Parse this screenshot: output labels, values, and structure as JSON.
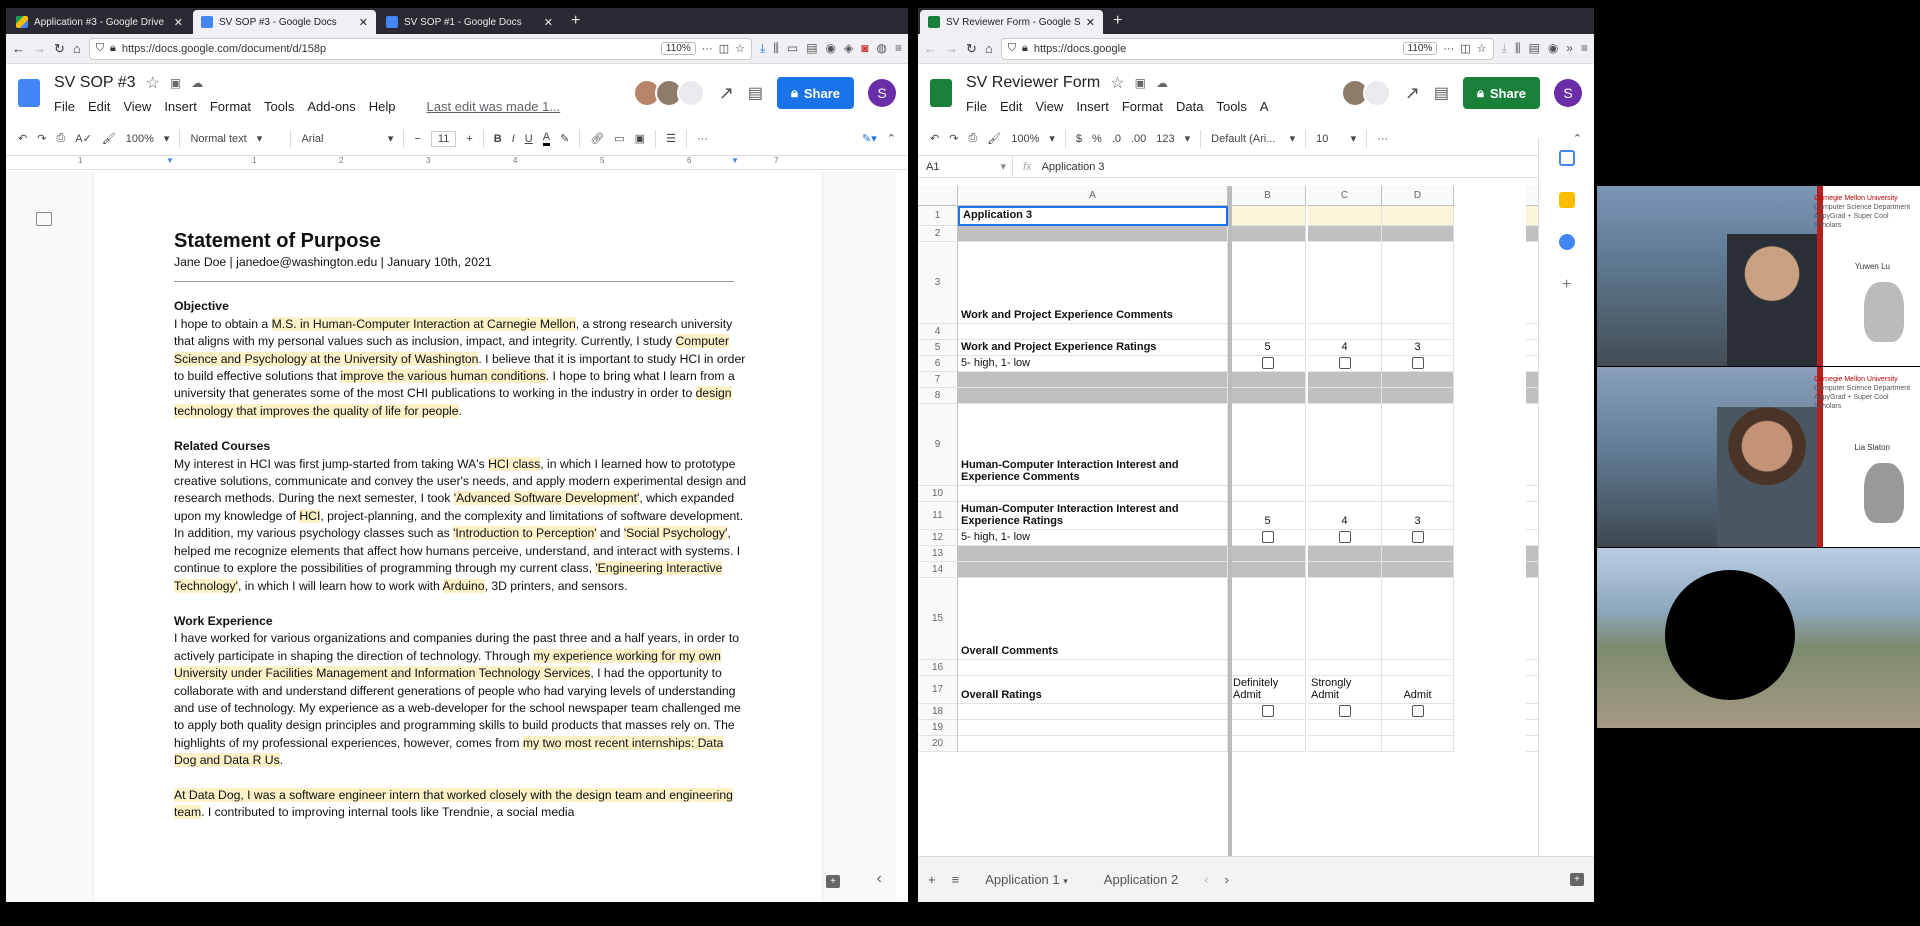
{
  "left_window": {
    "tabs": [
      {
        "title": "Application #3 - Google Drive",
        "active": false
      },
      {
        "title": "SV SOP #3 - Google Docs",
        "active": true
      },
      {
        "title": "SV SOP #1 - Google Docs",
        "active": false
      }
    ],
    "url": "https://docs.google.com/document/d/158p",
    "url_host": "docs.google.com",
    "zoom": "110%",
    "doc_name": "SV SOP #3",
    "menus": [
      "File",
      "Edit",
      "View",
      "Insert",
      "Format",
      "Tools",
      "Add-ons",
      "Help"
    ],
    "last_edit": "Last edit was made 1...",
    "share_label": "Share",
    "account_initial": "S",
    "toolbar": {
      "zoom": "100%",
      "style": "Normal text",
      "font": "Arial",
      "size": "11"
    },
    "ruler_numbers": [
      "1",
      "1",
      "2",
      "3",
      "4",
      "5",
      "6",
      "7"
    ],
    "document": {
      "title": "Statement of Purpose",
      "subtitle": "Jane Doe | janedoe@washington.edu | January 10th, 2021",
      "sections": [
        {
          "heading": "Objective",
          "segments": [
            {
              "t": "I hope to obtain a ",
              "h": false
            },
            {
              "t": "M.S. in Human-Computer Interaction at Carnegie Mellon",
              "h": true
            },
            {
              "t": ", a strong research university that aligns with my personal values such as inclusion, impact, and integrity. Currently, I study ",
              "h": false
            },
            {
              "t": "Computer Science and Psychology at the University of Washington",
              "h": true
            },
            {
              "t": ". I believe that it is important to study HCI in order to build effective solutions that ",
              "h": false
            },
            {
              "t": "improve the various human conditions",
              "h": true
            },
            {
              "t": ". I hope to bring what I learn from a university that generates some of the most CHI publications to working in the industry in order to ",
              "h": false
            },
            {
              "t": "design technology that improves the quality of life for people",
              "h": true
            },
            {
              "t": ".",
              "h": false
            }
          ]
        },
        {
          "heading": "Related Courses",
          "segments": [
            {
              "t": "My interest in HCI was first jump-started from taking WA's ",
              "h": false
            },
            {
              "t": "HCI class",
              "h": true
            },
            {
              "t": ", in which I learned how to prototype creative solutions, communicate and convey the user's needs, and apply modern experimental design and research methods. During the next semester, I took ",
              "h": false
            },
            {
              "t": "'Advanced Software Development'",
              "h": true
            },
            {
              "t": ", which expanded upon my knowledge of ",
              "h": false
            },
            {
              "t": "HCI",
              "h": true
            },
            {
              "t": ", project-planning, and the complexity and limitations of software development. In addition, my various psychology classes such as ",
              "h": false
            },
            {
              "t": "'Introduction to Perception'",
              "h": true
            },
            {
              "t": " and ",
              "h": false
            },
            {
              "t": "'Social Psychology'",
              "h": true
            },
            {
              "t": ", helped me recognize elements that affect how humans perceive, understand, and interact with systems. I continue to explore the possibilities of programming through my current class, ",
              "h": false
            },
            {
              "t": "'Engineering Interactive Technology'",
              "h": true
            },
            {
              "t": ", in which I will learn how to work with ",
              "h": false
            },
            {
              "t": "Arduino",
              "h": true
            },
            {
              "t": ", 3D printers, and sensors.",
              "h": false
            }
          ]
        },
        {
          "heading": "Work Experience",
          "segments": [
            {
              "t": "I have worked for various organizations and companies during the past three and a half years, in order to actively participate in shaping the direction of technology. Through ",
              "h": false
            },
            {
              "t": "my experience working for my own University under Facilities Management and Information Technology Services",
              "h": true
            },
            {
              "t": ", I had the opportunity to collaborate with and understand different generations of people who had varying levels of understanding and use of technology. My experience as a web-developer for the school newspaper team challenged me to apply both quality design principles and programming skills to build products that masses rely on. The highlights of my professional experiences, however, comes from ",
              "h": false
            },
            {
              "t": "my two most recent internships: Data Dog and Data R Us",
              "h": true
            },
            {
              "t": ".",
              "h": false
            }
          ]
        },
        {
          "heading": "",
          "segments": [
            {
              "t": "At Data Dog, I was a software engineer intern that worked closely with the design team and engineering team",
              "h": true
            },
            {
              "t": ". I contributed to improving internal tools like Trendnie, a social media",
              "h": false
            }
          ]
        }
      ]
    }
  },
  "right_window": {
    "tabs": [
      {
        "title": "SV Reviewer Form - Google Sh",
        "active": true
      }
    ],
    "url": "https://docs.google",
    "zoom": "110%",
    "doc_name": "SV Reviewer Form",
    "menus": [
      "File",
      "Edit",
      "View",
      "Insert",
      "Format",
      "Data",
      "Tools",
      "A"
    ],
    "share_label": "Share",
    "account_initial": "S",
    "toolbar": {
      "zoom": "100%",
      "currency": "$",
      "percent": "%",
      "dec1": ".0",
      "dec2": ".00",
      "numfmt": "123",
      "font": "Default (Ari...",
      "size": "10"
    },
    "cell_ref": "A1",
    "formula": "Application 3",
    "columns": [
      "A",
      "B",
      "C",
      "D"
    ],
    "rows": [
      {
        "n": "1",
        "a": "Application 3",
        "b": "",
        "c": "",
        "d": ""
      },
      {
        "n": "2",
        "a": "",
        "b": "",
        "c": "",
        "d": ""
      },
      {
        "n": "3",
        "a": "Work and Project Experience Comments",
        "b": "",
        "c": "",
        "d": ""
      },
      {
        "n": "4",
        "a": "",
        "b": "",
        "c": "",
        "d": ""
      },
      {
        "n": "5",
        "a": "Work and Project Experience Ratings",
        "b": "5",
        "c": "4",
        "d": "3"
      },
      {
        "n": "6",
        "a": "5- high, 1- low",
        "b": "",
        "c": "",
        "d": ""
      },
      {
        "n": "7",
        "a": "",
        "b": "",
        "c": "",
        "d": ""
      },
      {
        "n": "8",
        "a": "",
        "b": "",
        "c": "",
        "d": ""
      },
      {
        "n": "9",
        "a": "Human-Computer Interaction Interest and Experience Comments",
        "b": "",
        "c": "",
        "d": ""
      },
      {
        "n": "10",
        "a": "",
        "b": "",
        "c": "",
        "d": ""
      },
      {
        "n": "11",
        "a": "Human-Computer Interaction Interest and Experience Ratings",
        "b": "5",
        "c": "4",
        "d": "3"
      },
      {
        "n": "12",
        "a": "5- high, 1- low",
        "b": "",
        "c": "",
        "d": ""
      },
      {
        "n": "13",
        "a": "",
        "b": "",
        "c": "",
        "d": ""
      },
      {
        "n": "14",
        "a": "",
        "b": "",
        "c": "",
        "d": ""
      },
      {
        "n": "15",
        "a": "Overall Comments",
        "b": "",
        "c": "",
        "d": ""
      },
      {
        "n": "16",
        "a": "",
        "b": "",
        "c": "",
        "d": ""
      },
      {
        "n": "17",
        "a": "Overall Ratings",
        "b": "Definitely Admit",
        "c": "Strongly Admit",
        "d": "Admit"
      },
      {
        "n": "18",
        "a": "",
        "b": "",
        "c": "",
        "d": ""
      },
      {
        "n": "19",
        "a": "",
        "b": "",
        "c": "",
        "d": ""
      },
      {
        "n": "20",
        "a": "",
        "b": "",
        "c": "",
        "d": ""
      }
    ],
    "sheet_tabs": [
      "Application 1",
      "Application 2"
    ]
  },
  "video_tiles": [
    {
      "name": "Yuwen Lu",
      "logo_title": "Carnegie Mellon University",
      "logo_sub": "Computer Science Department",
      "logo_tag": "AppyGrad + Super Cool Scholars"
    },
    {
      "name": "Lia Slaton",
      "logo_title": "Carnegie Mellon University",
      "logo_sub": "Computer Science Department",
      "logo_tag": "AppyGrad + Super Cool Scholars"
    },
    {
      "name": ""
    }
  ],
  "colors": {
    "docs_blue": "#4285f4",
    "sheets_green": "#188038",
    "share_blue": "#1a73e8",
    "share_green": "#188038",
    "highlight": "#fcf1c7"
  }
}
